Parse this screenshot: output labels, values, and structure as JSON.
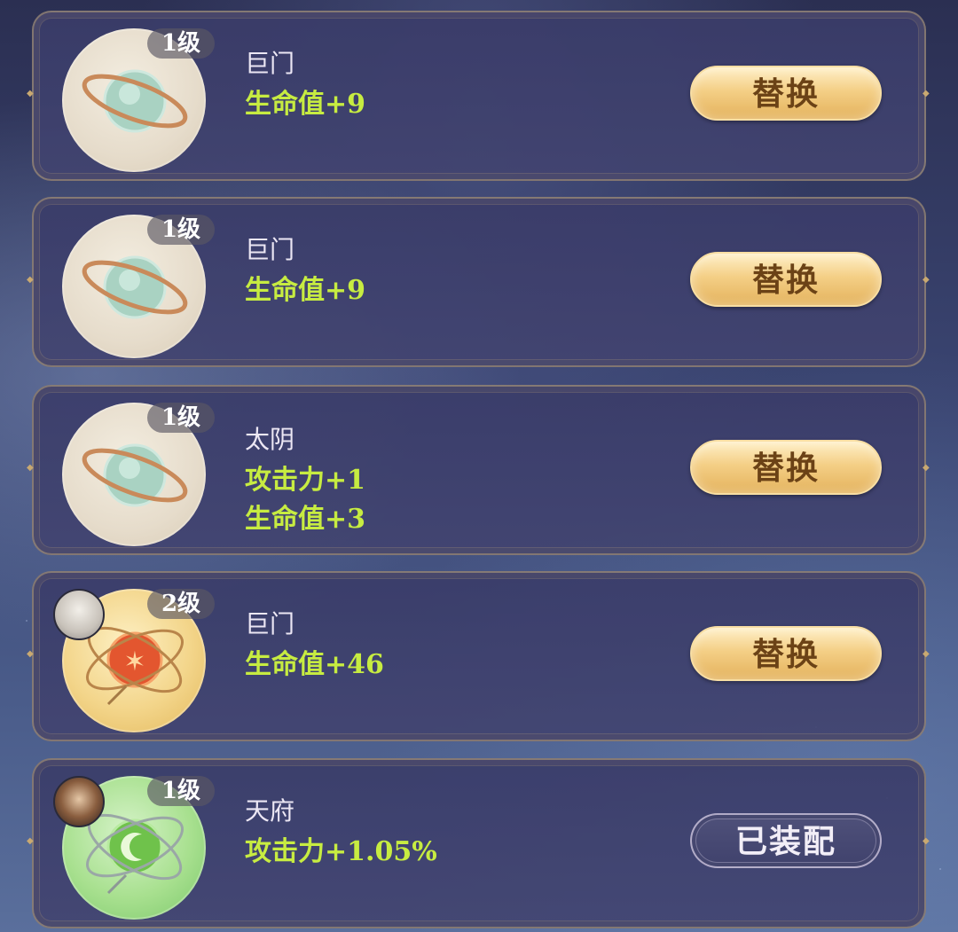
{
  "items": [
    {
      "level": "1级",
      "orb_style": "beige",
      "orb_icon": "planet-ring-icon",
      "name": "巨门",
      "stats": [
        "生命值+9"
      ],
      "action_label": "替换",
      "action_type": "replace",
      "avatar": null
    },
    {
      "level": "1级",
      "orb_style": "beige",
      "orb_icon": "planet-ring-icon",
      "name": "巨门",
      "stats": [
        "生命值+9"
      ],
      "action_label": "替换",
      "action_type": "replace",
      "avatar": null
    },
    {
      "level": "1级",
      "orb_style": "beige",
      "orb_icon": "planet-ring-icon",
      "name": "太阴",
      "stats": [
        "攻击力+1",
        "生命值+3"
      ],
      "action_label": "替换",
      "action_type": "replace",
      "avatar": null
    },
    {
      "level": "2级",
      "orb_style": "gold",
      "orb_icon": "star-orb-icon",
      "name": "巨门",
      "stats": [
        "生命值+46"
      ],
      "action_label": "替换",
      "action_type": "replace",
      "avatar": "white-haired-character-avatar"
    },
    {
      "level": "1级",
      "orb_style": "green",
      "orb_icon": "moon-orb-icon",
      "name": "天府",
      "stats": [
        "攻击力+1.05%"
      ],
      "action_label": "已装配",
      "action_type": "equipped",
      "avatar": "dark-haired-character-avatar"
    }
  ],
  "colors": {
    "stat_text": "#c7ec41",
    "name_text": "#ece7f4",
    "replace_button": "#f4cf86",
    "equipped_button_border": "#d7cde6",
    "card_bg": "#3a3c69"
  }
}
